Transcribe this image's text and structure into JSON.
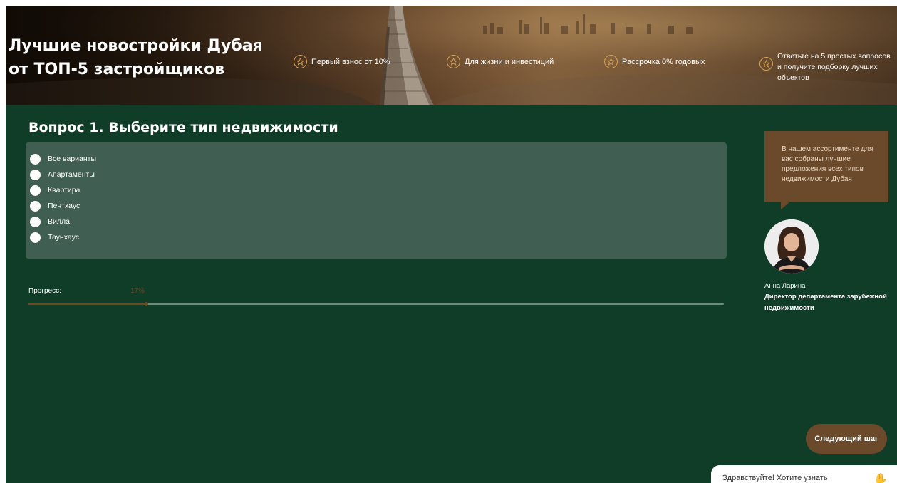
{
  "hero": {
    "title_line1": "Лучшие новостройки Дубая",
    "title_line2": "от ТОП-5 застройщиков",
    "features": [
      {
        "icon": "star-icon",
        "label": "Первый взнос от 10%"
      },
      {
        "icon": "star-icon",
        "label": "Для жизни и инвестиций"
      },
      {
        "icon": "star-icon",
        "label": "Рассрочка 0% годовых"
      }
    ],
    "cta_feature": {
      "icon": "star-icon",
      "line1": "Ответьте на 5 простых вопросов",
      "line2": "и получите подборку лучших",
      "line3": "объектов"
    }
  },
  "quiz": {
    "question": "Вопрос 1. Выберите тип недвижимости",
    "options": [
      "Все варианты",
      "Апартаменты",
      "Квартира",
      "Пентхаус",
      "Вилла",
      "Таунхаус"
    ],
    "progress_label": "Прогресс:",
    "progress_text": "17%",
    "progress_value": 0.17,
    "next_label": "Следующий шаг"
  },
  "advisor": {
    "bubble_text": "В нашем ассортименте для вас собраны лучшие предложения всех типов недвижимости Дубая",
    "name": "Анна Ларина -",
    "role": "Директор департамента зарубежной недвижимости"
  },
  "chat": {
    "text": "Здравствуйте! Хотите узнать",
    "icon": "hand-wave-icon"
  },
  "colors": {
    "background": "#0f3d28",
    "panel": "#415e52",
    "accent": "#6a4a2b",
    "star": "#d4a154"
  }
}
